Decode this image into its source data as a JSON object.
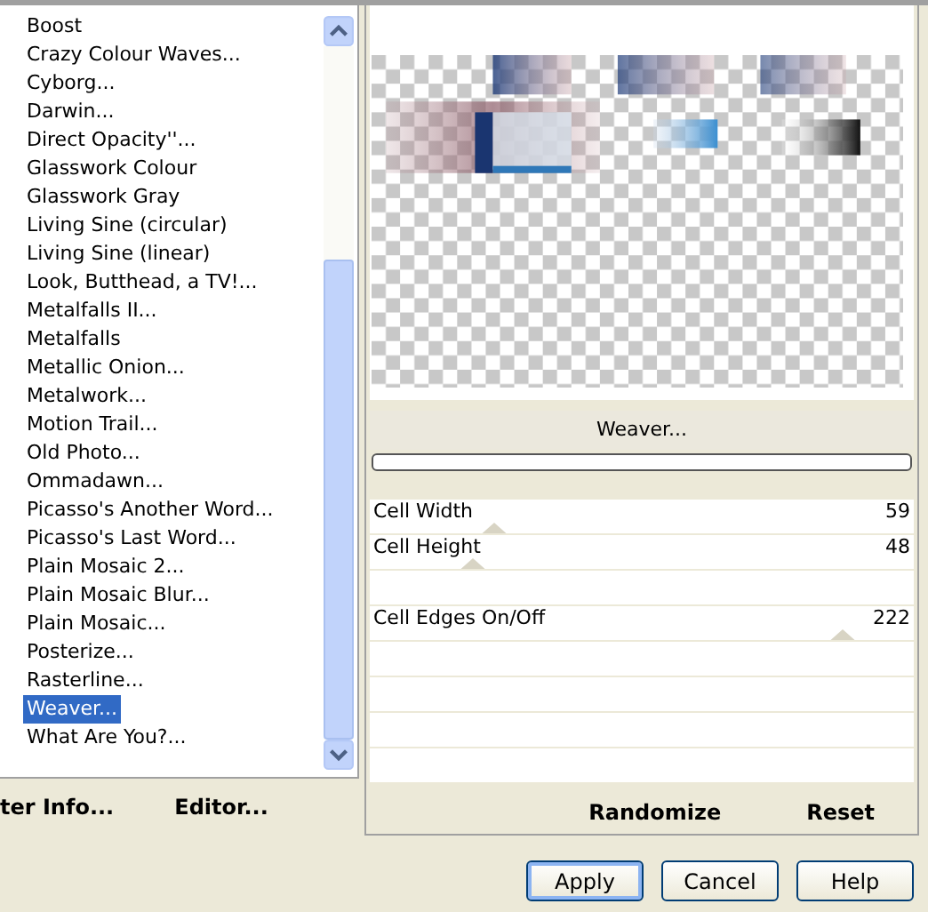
{
  "filters": [
    {
      "label": "Boost",
      "selected": false
    },
    {
      "label": "Crazy Colour Waves...",
      "selected": false
    },
    {
      "label": "Cyborg...",
      "selected": false
    },
    {
      "label": "Darwin...",
      "selected": false
    },
    {
      "label": "Direct Opacity''...",
      "selected": false
    },
    {
      "label": "Glasswork Colour",
      "selected": false
    },
    {
      "label": "Glasswork Gray",
      "selected": false
    },
    {
      "label": "Living Sine (circular)",
      "selected": false
    },
    {
      "label": "Living Sine (linear)",
      "selected": false
    },
    {
      "label": "Look, Butthead, a TV!...",
      "selected": false
    },
    {
      "label": "Metalfalls II...",
      "selected": false
    },
    {
      "label": "Metalfalls",
      "selected": false
    },
    {
      "label": "Metallic Onion...",
      "selected": false
    },
    {
      "label": "Metalwork...",
      "selected": false
    },
    {
      "label": "Motion Trail...",
      "selected": false
    },
    {
      "label": "Old Photo...",
      "selected": false
    },
    {
      "label": "Ommadawn...",
      "selected": false
    },
    {
      "label": "Picasso's Another Word...",
      "selected": false
    },
    {
      "label": "Picasso's Last Word...",
      "selected": false
    },
    {
      "label": "Plain Mosaic 2...",
      "selected": false
    },
    {
      "label": "Plain Mosaic Blur...",
      "selected": false
    },
    {
      "label": "Plain Mosaic...",
      "selected": false
    },
    {
      "label": "Posterize...",
      "selected": false
    },
    {
      "label": "Rasterline...",
      "selected": false
    },
    {
      "label": "Weaver...",
      "selected": true
    },
    {
      "label": "What Are You?...",
      "selected": false
    }
  ],
  "list_buttons": [
    "ter Info...",
    "Editor..."
  ],
  "preview": {
    "kind": "picture"
  },
  "filter_title": "Weaver...",
  "controls": [
    {
      "kind": "slider",
      "label": "Cell Width",
      "value": "59",
      "level": 0.23
    },
    {
      "kind": "slider",
      "label": "Cell Height",
      "value": "48",
      "level": 0.19
    },
    {
      "kind": "empty"
    },
    {
      "kind": "slider",
      "label": "Cell Edges On/Off",
      "value": "222",
      "level": 0.87
    },
    {
      "kind": "empty"
    },
    {
      "kind": "empty"
    },
    {
      "kind": "empty"
    },
    {
      "kind": "empty"
    }
  ],
  "panel_buttons": [
    "Randomize",
    "Reset"
  ],
  "dialog_buttons": [
    {
      "label": "Apply",
      "default": true
    },
    {
      "label": "Cancel",
      "default": false
    },
    {
      "label": "Help",
      "default": false
    }
  ]
}
